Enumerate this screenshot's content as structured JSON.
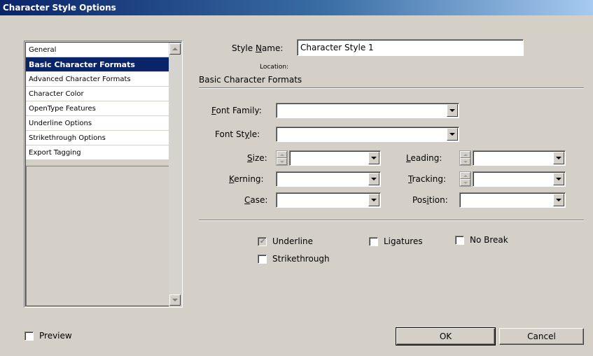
{
  "window": {
    "title": "Character Style Options"
  },
  "sidebar": {
    "items": [
      {
        "label": "General"
      },
      {
        "label": "Basic Character Formats"
      },
      {
        "label": "Advanced Character Formats"
      },
      {
        "label": "Character Color"
      },
      {
        "label": "OpenType Features"
      },
      {
        "label": "Underline Options"
      },
      {
        "label": "Strikethrough Options"
      },
      {
        "label": "Export Tagging"
      }
    ],
    "selected_index": 1
  },
  "style_name": {
    "label_pre": "Style ",
    "label_key": "N",
    "label_post": "ame:",
    "value": "Character Style 1"
  },
  "location": {
    "label": "Location:"
  },
  "section": {
    "title": "Basic Character Formats"
  },
  "fields": {
    "font_family": {
      "label_key": "F",
      "label_post": "ont Family:",
      "value": ""
    },
    "font_style": {
      "label_pre": "Font St",
      "label_key": "y",
      "label_post": "le:",
      "value": ""
    },
    "size": {
      "label_key": "S",
      "label_post": "ize:",
      "value": ""
    },
    "leading": {
      "label_key": "L",
      "label_post": "eading:",
      "value": ""
    },
    "kerning": {
      "label_key": "K",
      "label_post": "erning:",
      "value": ""
    },
    "tracking": {
      "label_key": "T",
      "label_post": "racking:",
      "value": ""
    },
    "case": {
      "label_key": "C",
      "label_post": "ase:",
      "value": ""
    },
    "position": {
      "label_pre": "Pos",
      "label_key": "i",
      "label_post": "tion:",
      "value": ""
    }
  },
  "options": {
    "underline": {
      "label": "Underline",
      "checked": true,
      "disabled": true
    },
    "ligatures": {
      "label": "Ligatures",
      "checked": false
    },
    "no_break": {
      "label": "No Break",
      "checked": false
    },
    "strikethrough": {
      "label": "Strikethrough",
      "checked": false
    }
  },
  "preview": {
    "label": "Preview",
    "checked": false
  },
  "buttons": {
    "ok": "OK",
    "cancel": "Cancel"
  },
  "icons": {
    "check": "✔",
    "dropdown": "chevron-down-icon"
  }
}
